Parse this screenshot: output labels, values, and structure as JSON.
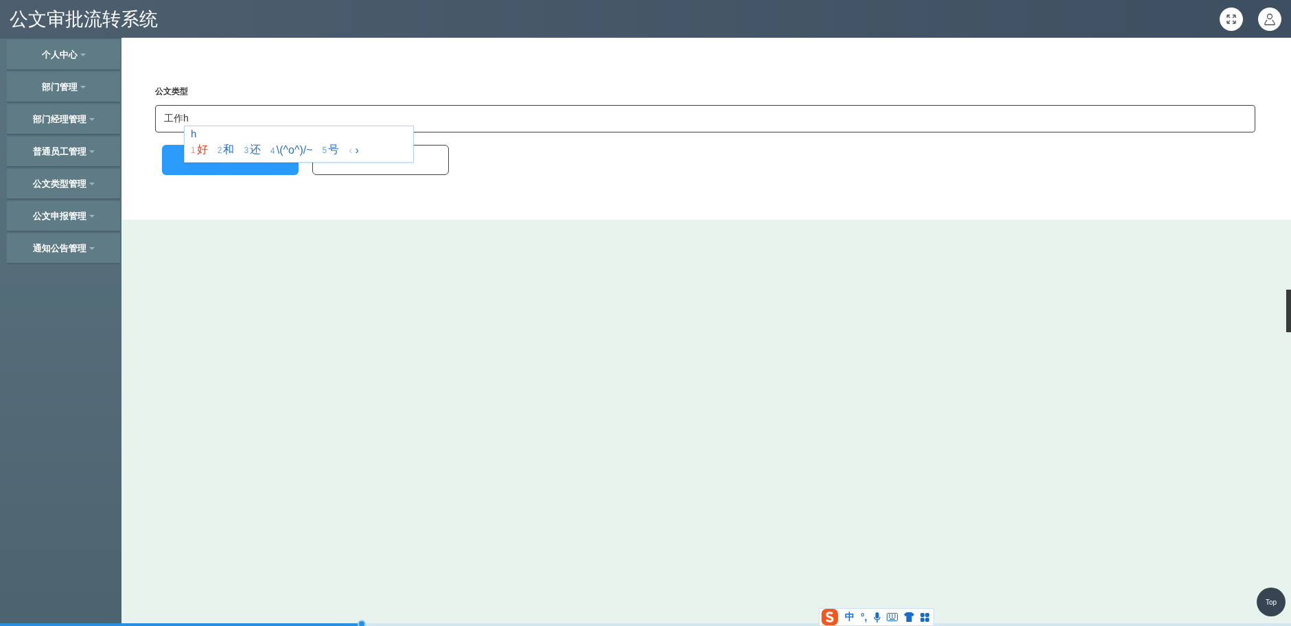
{
  "header": {
    "title": "公文审批流转系统"
  },
  "sidebar": {
    "items": [
      {
        "label": "个人中心"
      },
      {
        "label": "部门管理"
      },
      {
        "label": "部门经理管理"
      },
      {
        "label": "普通员工管理"
      },
      {
        "label": "公文类型管理"
      },
      {
        "label": "公文申报管理"
      },
      {
        "label": "通知公告管理"
      }
    ]
  },
  "form": {
    "field": {
      "label": "公文类型",
      "value": "工作h"
    },
    "buttons": [
      {
        "kind": "primary"
      },
      {
        "kind": "plain"
      }
    ]
  },
  "ime_popup": {
    "input": "h",
    "candidates": [
      {
        "index": "1",
        "text": "好",
        "selected": true
      },
      {
        "index": "2",
        "text": "和",
        "selected": false
      },
      {
        "index": "3",
        "text": "还",
        "selected": false
      },
      {
        "index": "4",
        "text": "\\(^o^)/~",
        "selected": false
      },
      {
        "index": "5",
        "text": "号",
        "selected": false
      }
    ],
    "prev": "‹",
    "next": "›"
  },
  "ime_toolbar": {
    "mode": "中",
    "punctuation": "°,"
  },
  "back_to_top": {
    "label": "Top"
  },
  "progress": {
    "level": 0.28
  }
}
